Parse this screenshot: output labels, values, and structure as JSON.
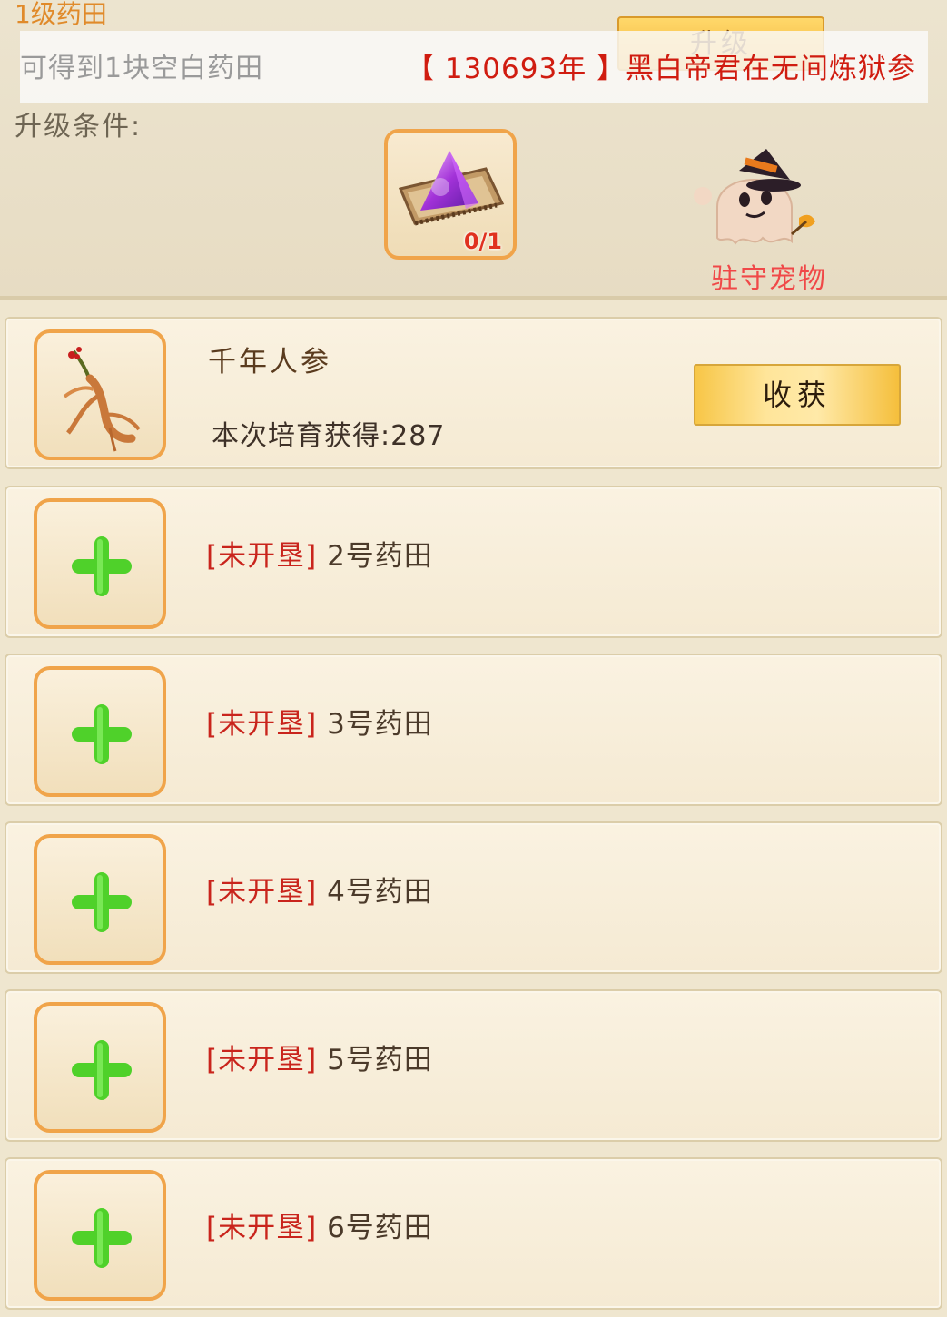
{
  "header": {
    "level_title": "1级药田",
    "upgrade_button": "升级",
    "hidden_first_char": "可",
    "ticker_left": "可得到1块空白药田",
    "ticker_right": "【 130693年 】黑白帝君在无间炼狱参",
    "conditions_label": "升级条件:",
    "material": {
      "icon": "purple-crystal-on-scroll-icon",
      "count": "0/1"
    },
    "pet_label": "驻守宠物",
    "pet_icon": "ghost-witch-hat-pet-icon"
  },
  "planted_field": {
    "icon": "ginseng-icon",
    "name": "千年人参",
    "yield_text": "本次培育获得:287",
    "harvest_button": "收获"
  },
  "fields": [
    {
      "status": "[未开垦]",
      "name": "2号药田"
    },
    {
      "status": "[未开垦]",
      "name": "3号药田"
    },
    {
      "status": "[未开垦]",
      "name": "4号药田"
    },
    {
      "status": "[未开垦]",
      "name": "5号药田"
    },
    {
      "status": "[未开垦]",
      "name": "6号药田"
    }
  ],
  "colors": {
    "accent_orange": "#f0a44a",
    "status_red": "#c9241c",
    "plus_green": "#4fd12a",
    "ticker_red": "#d01c10"
  }
}
